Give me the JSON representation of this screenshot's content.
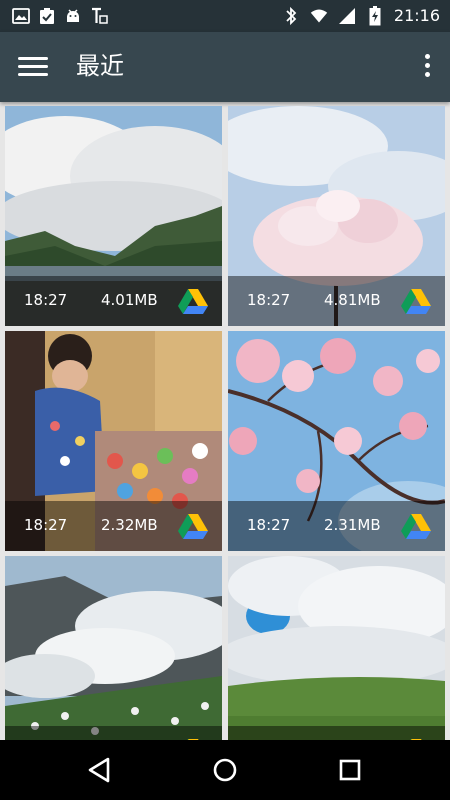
{
  "status_bar": {
    "time": "21:16",
    "left_icons": [
      "gallery-notification-icon",
      "task-done-icon",
      "android-debug-icon",
      "nfc-transfer-icon"
    ],
    "right_icons": [
      "bluetooth-icon",
      "wifi-icon",
      "signal-icon",
      "battery-charging-icon"
    ]
  },
  "toolbar": {
    "title": "最近",
    "menu_icon": "hamburger-menu-icon",
    "overflow_icon": "more-vert-icon"
  },
  "files": [
    {
      "time": "18:27",
      "size": "4.01MB",
      "source": "google-drive-icon",
      "scene": "mountain-lake"
    },
    {
      "time": "18:27",
      "size": "4.81MB",
      "source": "google-drive-icon",
      "scene": "cherry-tree-sky"
    },
    {
      "time": "18:27",
      "size": "2.32MB",
      "source": "google-drive-icon",
      "scene": "child-at-festival-stall"
    },
    {
      "time": "18:27",
      "size": "2.31MB",
      "source": "google-drive-icon",
      "scene": "cherry-blossom-branch"
    },
    {
      "time": "",
      "size": "",
      "source": "google-drive-icon",
      "scene": "volcanic-steam-flowers"
    },
    {
      "time": "",
      "size": "",
      "source": "google-drive-icon",
      "scene": "green-hill-clouds"
    }
  ],
  "nav": {
    "back": "back-triangle-icon",
    "home": "home-circle-icon",
    "recents": "recents-square-icon"
  },
  "colors": {
    "status_bar": "#263238",
    "toolbar": "#37474F",
    "grid_background": "#e6e6e6",
    "nav_bar": "#000000"
  }
}
